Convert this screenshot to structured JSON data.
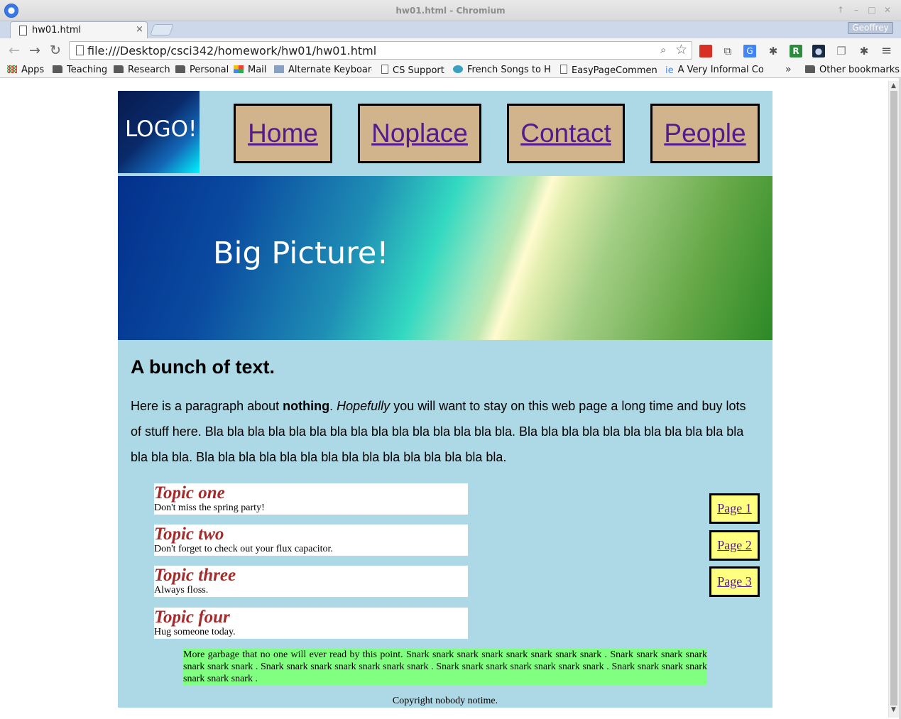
{
  "window": {
    "title": "hw01.html - Chromium",
    "controls": [
      "↑",
      "–",
      "□",
      "✕"
    ]
  },
  "tab": {
    "title": "hw01.html",
    "close": "×"
  },
  "profile": {
    "name": "Geoffrey"
  },
  "toolbar": {
    "back": "←",
    "forward": "→",
    "reload": "↻",
    "url": "file:///Desktop/csci342/homework/hw01/hw01.html",
    "zoom_icon": "⌕",
    "star_icon": "☆",
    "menu_icon": "≡"
  },
  "extensions": [
    {
      "name": "bookmark-ext-icon",
      "color": "#d93025",
      "glyph": ""
    },
    {
      "name": "cast-icon",
      "color": "#ffffff",
      "glyph": "⧉"
    },
    {
      "name": "translate-icon",
      "color": "#4285f4",
      "glyph": "G"
    },
    {
      "name": "puzzle-icon",
      "color": "#ffffff",
      "glyph": "✱"
    },
    {
      "name": "r-ext-icon",
      "color": "#2e8b3d",
      "glyph": "R"
    },
    {
      "name": "dark-ext-icon",
      "color": "#1b2a44",
      "glyph": "●"
    },
    {
      "name": "layers-ext-icon",
      "color": "#ffffff",
      "glyph": "❐"
    },
    {
      "name": "puzzle2-icon",
      "color": "#ffffff",
      "glyph": "✱"
    }
  ],
  "bookmarks": {
    "items": [
      {
        "label": "Apps",
        "icon": "apps-grid"
      },
      {
        "label": "Teaching",
        "icon": "folder"
      },
      {
        "label": "Research",
        "icon": "folder"
      },
      {
        "label": "Personal",
        "icon": "folder"
      },
      {
        "label": "Mail",
        "icon": "mail"
      },
      {
        "label": "Alternate Keyboards",
        "icon": "keyboard"
      },
      {
        "label": "CS Support",
        "icon": "page"
      },
      {
        "label": "French Songs to Help",
        "icon": "globe"
      },
      {
        "label": "EasyPageComments",
        "icon": "page"
      },
      {
        "label": "A Very Informal Con",
        "icon": "ie"
      }
    ],
    "more": "»",
    "other": "Other bookmarks"
  },
  "page": {
    "logo": "LOGO!",
    "nav": [
      "Home",
      "Noplace",
      "Contact",
      "People"
    ],
    "hero": "Big Picture!",
    "heading": "A bunch of text.",
    "paragraph": {
      "p1": "Here is a paragraph about ",
      "bold": "nothing",
      "p2": ". ",
      "italic": "Hopefully",
      "p3": " you will want to stay on this web page a long time and buy lots of stuff here. Bla bla bla bla bla bla bla bla bla bla bla bla bla bla bla. Bla bla bla bla bla bla bla bla bla bla bla bla bla bla. Bla bla bla bla bla bla bla bla bla bla bla bla bla bla bla."
    },
    "topics": [
      {
        "title": "Topic one",
        "desc": "Don't miss the spring party!"
      },
      {
        "title": "Topic two",
        "desc": "Don't forget to check out your flux capacitor."
      },
      {
        "title": "Topic three",
        "desc": "Always floss."
      },
      {
        "title": "Topic four",
        "desc": "Hug someone today."
      }
    ],
    "pages": [
      "Page 1",
      "Page 2",
      "Page 3"
    ],
    "garbage": "More garbage that no one will ever read by this point. Snark snark snark snark snark snark snark snark . Snark snark snark snark snark snark snark . Snark snark snark snark snark snark snark . Snark snark snark snark snark snark snark . Snark snark snark snark snark snark snark .",
    "copyright": "Copyright nobody notime."
  },
  "colors": {
    "page_bg": "#add8e6",
    "nav_button": "#d2b48c",
    "link": "#551a8b",
    "topic_title": "#a52a2a",
    "page_button": "#ffff80",
    "garbage_bg": "#80ff80"
  }
}
